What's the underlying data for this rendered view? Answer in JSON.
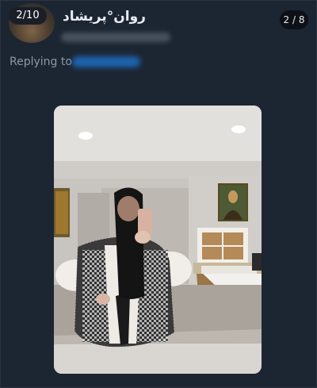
{
  "header": {
    "media_counter": "2/10",
    "user_name": "روان°پریشاد",
    "page_indicator": "2 / 8"
  },
  "reply": {
    "label": "Replying to"
  },
  "colors": {
    "background": "#1c2532",
    "muted_text": "#8b98a5",
    "link": "#1d9bf0"
  },
  "icons": {
    "avatar": "profile-avatar"
  }
}
